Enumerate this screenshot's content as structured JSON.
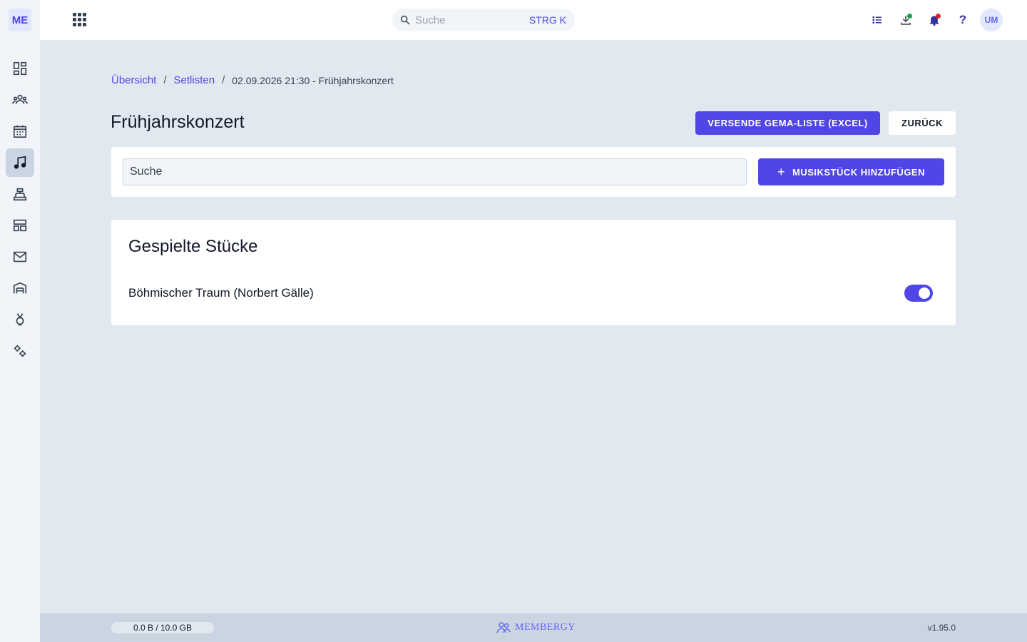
{
  "sidebar": {
    "logo": "ME",
    "items": [
      {
        "name": "dashboard",
        "icon": "dashboard-icon"
      },
      {
        "name": "members",
        "icon": "people-icon"
      },
      {
        "name": "calendar",
        "icon": "calendar-icon"
      },
      {
        "name": "music",
        "icon": "music-note-icon",
        "active": true
      },
      {
        "name": "cash-register",
        "icon": "cash-register-icon"
      },
      {
        "name": "tables",
        "icon": "table-icon"
      },
      {
        "name": "mail",
        "icon": "mail-icon"
      },
      {
        "name": "warehouse",
        "icon": "warehouse-icon"
      },
      {
        "name": "awards",
        "icon": "medal-icon"
      },
      {
        "name": "settings",
        "icon": "gears-icon"
      }
    ]
  },
  "topbar": {
    "search_placeholder": "Suche",
    "search_shortcut": "STRG K",
    "help_label": "?",
    "avatar_initials": "UM",
    "download_dot_color": "#16a34a",
    "bell_dot_color": "#dc2626"
  },
  "breadcrumb": {
    "items": [
      "Übersicht",
      "Setlisten"
    ],
    "separator": "/",
    "current": "02.09.2026 21:30 - Frühjahrskonzert"
  },
  "page": {
    "title": "Frühjahrskonzert",
    "gema_button": "VERSENDE GEMA-LISTE (EXCEL)",
    "back_button": "ZURÜCK"
  },
  "toolbar": {
    "search_placeholder": "Suche",
    "add_button": "MUSIKSTÜCK HINZUFÜGEN",
    "add_icon": "+"
  },
  "played": {
    "title": "Gespielte Stücke",
    "pieces": [
      {
        "name": "Böhmischer Traum (Norbert Gälle)",
        "enabled": true
      }
    ]
  },
  "footer": {
    "storage": "0.0 B / 10.0 GB",
    "brand": "MEMBERGY",
    "version": "v1.95.0"
  },
  "colors": {
    "accent": "#4f46e5",
    "background": "#e2e8f0",
    "sidebar": "#f1f5f9"
  }
}
